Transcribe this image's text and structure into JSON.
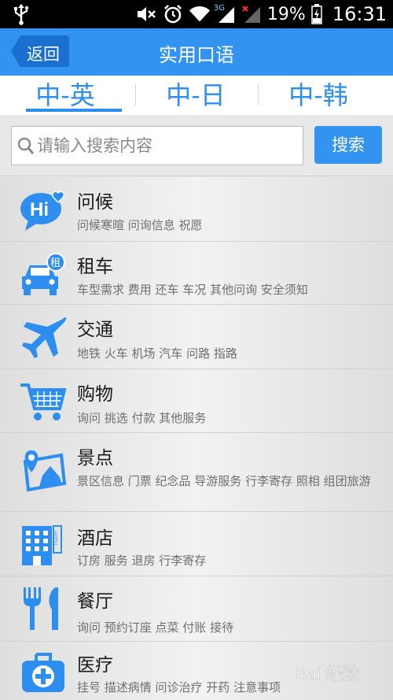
{
  "status": {
    "battery": "19%",
    "time": "16:31",
    "network": "3G",
    "icons": [
      "usb-icon",
      "mute-icon",
      "alarm-icon",
      "wifi-icon",
      "signal-icon",
      "battery-icon"
    ]
  },
  "header": {
    "back_label": "返回",
    "title": "实用口语"
  },
  "tabs": [
    {
      "label": "中-英",
      "active": true
    },
    {
      "label": "中-日",
      "active": false
    },
    {
      "label": "中-韩",
      "active": false
    }
  ],
  "search": {
    "placeholder": "请输入搜索内容",
    "button": "搜索"
  },
  "categories": [
    {
      "title": "问候",
      "subtitle": "问候寒暄 问询信息 祝愿",
      "icon": "hi-bubble-icon"
    },
    {
      "title": "租车",
      "subtitle": "车型需求 费用 还车 车况 其他问询 安全须知",
      "icon": "car-rental-icon"
    },
    {
      "title": "交通",
      "subtitle": "地铁 火车 机场 汽车 问路 指路",
      "icon": "airplane-icon"
    },
    {
      "title": "购物",
      "subtitle": "询问 挑选 付款 其他服务",
      "icon": "shopping-cart-icon"
    },
    {
      "title": "景点",
      "subtitle": "景区信息 门票 纪念品 导游服务 行李寄存 照相 组团旅游",
      "icon": "map-photo-icon"
    },
    {
      "title": "酒店",
      "subtitle": "订房 服务 退房 行李寄存",
      "icon": "hotel-icon"
    },
    {
      "title": "餐厅",
      "subtitle": "询问 预约订座 点菜 付账 接待",
      "icon": "fork-knife-icon"
    },
    {
      "title": "医疗",
      "subtitle": "挂号 描述病情 问诊治疗 开药 注意事项",
      "icon": "medical-kit-icon"
    }
  ],
  "icon_color": "#2e8ef0",
  "accent_color": "#3393f0",
  "rental_badge": "租",
  "hotel_sign": "HOTEL",
  "watermark": "Bai 经验"
}
